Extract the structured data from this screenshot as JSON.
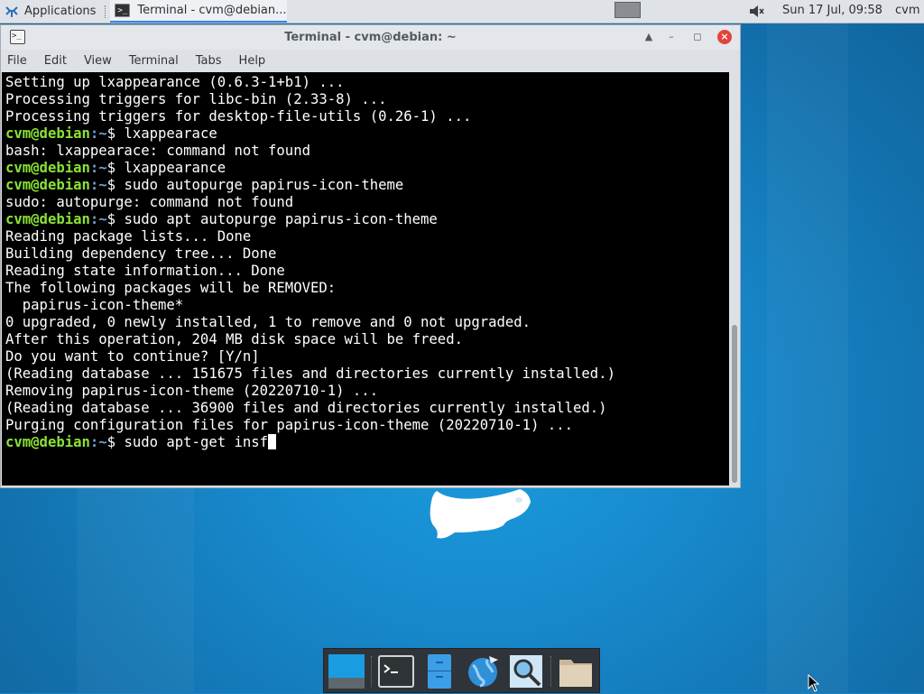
{
  "top_panel": {
    "apps_label": "Applications",
    "task_label": "Terminal - cvm@debian...",
    "clock": "Sun 17 Jul, 09:58",
    "user": "cvm",
    "icons": [
      "xfce-mouse-icon",
      "terminal-icon",
      "volume-muted-icon"
    ]
  },
  "window": {
    "title": "Terminal - cvm@debian: ~",
    "menu": [
      "File",
      "Edit",
      "View",
      "Terminal",
      "Tabs",
      "Help"
    ],
    "controls": [
      "shade-icon",
      "minimize-icon",
      "maximize-icon",
      "close-icon"
    ]
  },
  "terminal": {
    "prompt_user": "cvm@debian",
    "prompt_path": ":~",
    "prompt_symbol": "$",
    "lines": [
      {
        "type": "out",
        "text": "Setting up lxappearance (0.6.3-1+b1) ..."
      },
      {
        "type": "out",
        "text": "Processing triggers for libc-bin (2.33-8) ..."
      },
      {
        "type": "out",
        "text": "Processing triggers for desktop-file-utils (0.26-1) ..."
      },
      {
        "type": "cmd",
        "text": " lxappearace"
      },
      {
        "type": "out",
        "text": "bash: lxappearace: command not found"
      },
      {
        "type": "cmd",
        "text": " lxappearance"
      },
      {
        "type": "cmd",
        "text": " sudo autopurge papirus-icon-theme"
      },
      {
        "type": "out",
        "text": "sudo: autopurge: command not found"
      },
      {
        "type": "cmd",
        "text": " sudo apt autopurge papirus-icon-theme"
      },
      {
        "type": "out",
        "text": "Reading package lists... Done"
      },
      {
        "type": "out",
        "text": "Building dependency tree... Done"
      },
      {
        "type": "out",
        "text": "Reading state information... Done"
      },
      {
        "type": "out",
        "text": "The following packages will be REMOVED:"
      },
      {
        "type": "out",
        "text": "  papirus-icon-theme*"
      },
      {
        "type": "out",
        "text": "0 upgraded, 0 newly installed, 1 to remove and 0 not upgraded."
      },
      {
        "type": "out",
        "text": "After this operation, 204 MB disk space will be freed."
      },
      {
        "type": "out",
        "text": "Do you want to continue? [Y/n]"
      },
      {
        "type": "out",
        "text": "(Reading database ... 151675 files and directories currently installed.)"
      },
      {
        "type": "out",
        "text": "Removing papirus-icon-theme (20220710-1) ..."
      },
      {
        "type": "out",
        "text": "(Reading database ... 36900 files and directories currently installed.)"
      },
      {
        "type": "out",
        "text": "Purging configuration files for papirus-icon-theme (20220710-1) ..."
      },
      {
        "type": "cur",
        "text": " sudo apt-get insf"
      }
    ]
  },
  "dock": {
    "items": [
      "show-desktop-icon",
      "terminal-icon",
      "file-manager-icon",
      "web-browser-icon",
      "app-finder-icon",
      "folder-icon"
    ]
  },
  "colors": {
    "prompt_green": "#8ae234",
    "prompt_blue": "#729fcf",
    "desktop_blue": "#1583c4",
    "close_red": "#e2453c"
  }
}
